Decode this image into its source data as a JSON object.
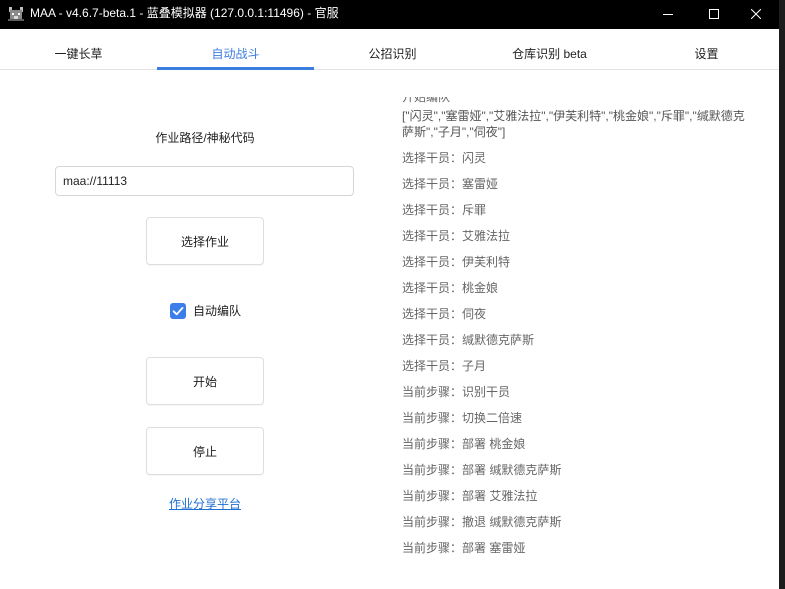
{
  "window": {
    "title": "MAA - v4.6.7-beta.1 - 蓝叠模拟器 (127.0.0.1:11496) - 官服",
    "logo_icon": "app-logo-icon",
    "controls": {
      "minimize_icon": "minimize-icon",
      "maximize_icon": "maximize-icon",
      "close_icon": "close-icon"
    }
  },
  "theme": {
    "titlebar_bg": "#000000",
    "accent": "#3c7de0",
    "checkbox": "#3b7de9",
    "link": "#1f6fd0"
  },
  "tabs": [
    {
      "label": "一键长草",
      "active": false
    },
    {
      "label": "自动战斗",
      "active": true
    },
    {
      "label": "公招识别",
      "active": false
    },
    {
      "label": "仓库识别 beta",
      "active": false
    },
    {
      "label": "设置",
      "active": false
    }
  ],
  "copilot": {
    "path_label": "作业路径/神秘代码",
    "path_input": {
      "value": "maa://11113"
    },
    "select_button": "选择作业",
    "auto_formation": {
      "label": "自动编队",
      "checked": true,
      "check_icon": "checkmark-icon"
    },
    "start_button": "开始",
    "stop_button": "停止",
    "share_link": "作业分享平台"
  },
  "log": {
    "entries": [
      {
        "text": "开始编队",
        "color": "#666666"
      },
      {
        "text": "[\"闪灵\",\"塞雷娅\",\"艾雅法拉\",\"伊芙利特\",\"桃金娘\",\"斥罪\",\"缄默德克萨斯\",\"子月\",\"伺夜\"]",
        "color": "#555555"
      },
      {
        "text": "选择干员：闪灵",
        "color": "#666666"
      },
      {
        "text": "选择干员：塞雷娅",
        "color": "#666666"
      },
      {
        "text": "选择干员：斥罪",
        "color": "#666666"
      },
      {
        "text": "选择干员：艾雅法拉",
        "color": "#666666"
      },
      {
        "text": "选择干员：伊芙利特",
        "color": "#666666"
      },
      {
        "text": "选择干员：桃金娘",
        "color": "#666666"
      },
      {
        "text": "选择干员：伺夜",
        "color": "#666666"
      },
      {
        "text": "选择干员：缄默德克萨斯",
        "color": "#666666"
      },
      {
        "text": "选择干员：子月",
        "color": "#666666"
      },
      {
        "text": "当前步骤：识别干员",
        "color": "#666666"
      },
      {
        "text": "当前步骤：切换二倍速",
        "color": "#666666"
      },
      {
        "text": "当前步骤：部署 桃金娘",
        "color": "#666666"
      },
      {
        "text": "当前步骤：部署 缄默德克萨斯",
        "color": "#666666"
      },
      {
        "text": "当前步骤：部署 艾雅法拉",
        "color": "#666666"
      },
      {
        "text": "当前步骤：撤退 缄默德克萨斯",
        "color": "#666666"
      },
      {
        "text": "当前步骤：部署 塞雷娅",
        "color": "#666666"
      }
    ]
  }
}
